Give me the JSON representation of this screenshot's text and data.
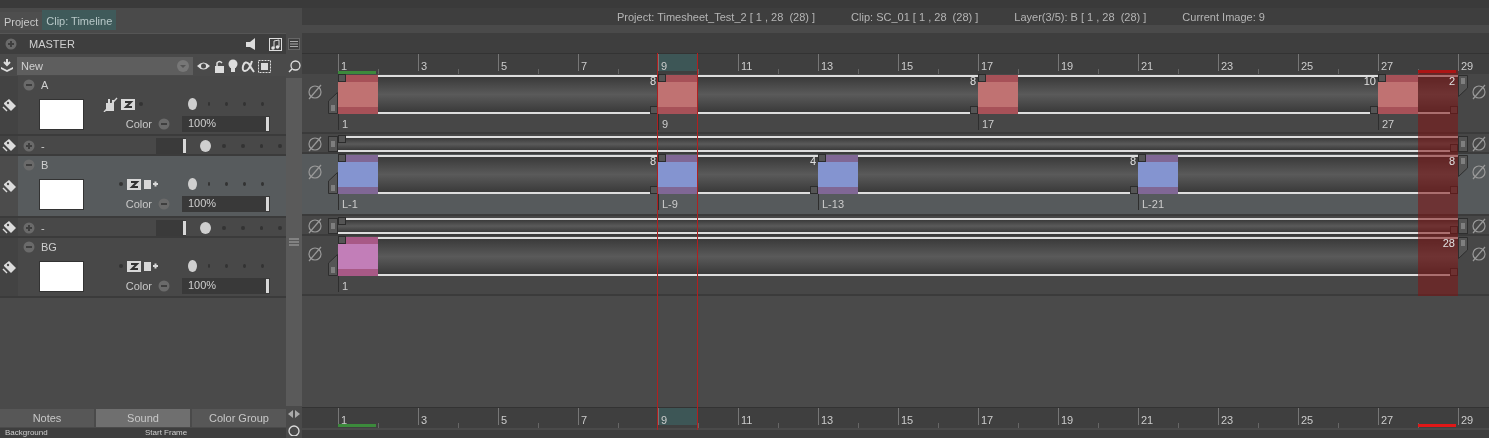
{
  "tabs": [
    {
      "label": "Project",
      "selected": false
    },
    {
      "label": "Clip: Timeline",
      "selected": true
    }
  ],
  "info": [
    "Project: Timesheet_Test_2 [ 1 , 28  (28) ]",
    "Clip: SC_01 [ 1 , 28  (28) ]",
    "Layer(3/5): B [ 1 , 28  (28) ]",
    "Current Image: 9"
  ],
  "master": {
    "label": "MASTER",
    "expanded": false
  },
  "layer_set": {
    "value": "New"
  },
  "layers": [
    {
      "kind": "paint",
      "name": "A",
      "expanded": true,
      "selected": false,
      "blend": "Color",
      "opacity": "100%",
      "level": 1
    },
    {
      "kind": "folder",
      "name": "-",
      "expanded": false,
      "selected": false,
      "level": 1
    },
    {
      "kind": "cel",
      "name": "B",
      "expanded": true,
      "selected": true,
      "blend": "Color",
      "opacity": "100%",
      "level": 1
    },
    {
      "kind": "folder",
      "name": "-",
      "expanded": false,
      "selected": false,
      "level": 1
    },
    {
      "kind": "cel",
      "name": "BG",
      "expanded": true,
      "selected": false,
      "blend": "Color",
      "opacity": "100%",
      "level": 1
    }
  ],
  "ruler": [
    {
      "label": "1",
      "selected": false
    },
    {
      "label": "3",
      "selected": false
    },
    {
      "label": "5",
      "selected": false
    },
    {
      "label": "7",
      "selected": false
    },
    {
      "label": "9",
      "selected": true
    },
    {
      "label": "11",
      "selected": false
    },
    {
      "label": "13",
      "selected": false
    },
    {
      "label": "15",
      "selected": false
    },
    {
      "label": "17",
      "selected": false
    },
    {
      "label": "19",
      "selected": false
    },
    {
      "label": "21",
      "selected": false
    },
    {
      "label": "23",
      "selected": false
    },
    {
      "label": "25",
      "selected": false
    },
    {
      "label": "27",
      "selected": false
    },
    {
      "label": "29",
      "selected": false
    }
  ],
  "tracks": [
    {
      "kind": "cels",
      "color": "#c07272",
      "end_label": "2",
      "cels": [
        {
          "below": "1"
        },
        {
          "above": "8",
          "below": "9"
        },
        {
          "above": "8",
          "below": "17"
        },
        {
          "above": "10",
          "below": "27"
        }
      ]
    },
    {
      "kind": "empty"
    },
    {
      "kind": "cels",
      "color": "#8494d0",
      "end_label": "8",
      "cels": [
        {
          "below": "L-1"
        },
        {
          "above": "8",
          "below": "L-9"
        },
        {
          "above": "4",
          "below": "L-13"
        },
        {
          "above": "8",
          "below": "L-21"
        }
      ]
    },
    {
      "kind": "empty"
    },
    {
      "kind": "cels",
      "color": "#c27eb8",
      "end_label": "28",
      "cels": [
        {
          "below": "1"
        }
      ]
    }
  ],
  "bottom_tabs": [
    {
      "label": "Notes",
      "selected": false
    },
    {
      "label": "Sound",
      "selected": true
    },
    {
      "label": "Color Group",
      "selected": false
    }
  ],
  "bottom_ruler": [
    {
      "label": "1",
      "selected": false
    },
    {
      "label": "3",
      "selected": false
    },
    {
      "label": "5",
      "selected": false
    },
    {
      "label": "7",
      "selected": false
    },
    {
      "label": "9",
      "selected": true
    },
    {
      "label": "11",
      "selected": false
    },
    {
      "label": "13",
      "selected": false
    },
    {
      "label": "15",
      "selected": false
    },
    {
      "label": "17",
      "selected": false
    },
    {
      "label": "19",
      "selected": false
    },
    {
      "label": "21",
      "selected": false
    },
    {
      "label": "23",
      "selected": false
    },
    {
      "label": "25",
      "selected": false
    },
    {
      "label": "27",
      "selected": false
    },
    {
      "label": "29",
      "selected": false
    }
  ],
  "footer": [
    "Background",
    "Start Frame"
  ]
}
